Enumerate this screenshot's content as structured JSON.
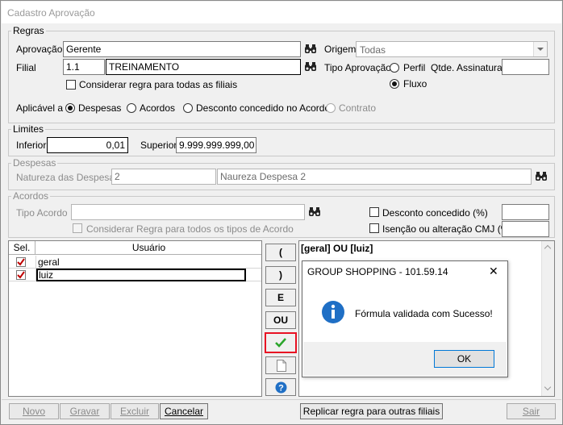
{
  "window": {
    "title": "Cadastro Aprovação"
  },
  "regras": {
    "legend": "Regras",
    "aprovacao_label": "Aprovação",
    "aprovacao_value": "Gerente",
    "origem_label": "Origem",
    "origem_value": "Todas",
    "filial_label": "Filial",
    "filial_code": "1.1",
    "filial_name": "TREINAMENTO",
    "tipo_aprovacao_label": "Tipo Aprovação",
    "perfil_label": "Perfil",
    "fluxo_label": "Fluxo",
    "qtde_label": "Qtde. Assinaturas",
    "qtde_value": "",
    "considerar_filiais_label": "Considerar regra para todas as filiais",
    "aplicavel_label": "Aplicável a",
    "aplicavel_options": [
      "Despesas",
      "Acordos",
      "Desconto concedido no Acordo",
      "Contrato"
    ]
  },
  "limites": {
    "legend": "Limites",
    "inferior_label": "Inferior",
    "inferior_value": "0,01",
    "superior_label": "Superior",
    "superior_value": "9.999.999.999,00"
  },
  "despesas": {
    "legend": "Despesas",
    "natureza_label": "Natureza das Despesas",
    "natureza_code": "2",
    "natureza_name": "Naureza Despesa 2"
  },
  "acordos": {
    "legend": "Acordos",
    "tipo_acordo_label": "Tipo Acordo",
    "tipo_acordo_value": "",
    "considerar_tipos_label": "Considerar Regra para todos os tipos de Acordo",
    "desconto_label": "Desconto concedido (%)",
    "desconto_value": "",
    "isencao_label": "Isenção ou alteração CMJ (%)",
    "isencao_value": ""
  },
  "users_table": {
    "headers": [
      "Sel.",
      "Usuário"
    ],
    "rows": [
      {
        "user": "geral"
      },
      {
        "user": "luiz"
      }
    ]
  },
  "operators": {
    "open": "(",
    "close": ")",
    "and": "E",
    "or": "OU"
  },
  "formula": "[geral] OU [luiz]",
  "dialog": {
    "title": "GROUP SHOPPING - 101.59.14",
    "message": "Fórmula validada com Sucesso!",
    "ok": "OK",
    "close_glyph": "✕"
  },
  "bottom": {
    "novo": "Novo",
    "gravar": "Gravar",
    "excluir": "Excluir",
    "cancelar": "Cancelar",
    "replicar": "Replicar regra para outras filiais",
    "sair": "Sair"
  },
  "colors": {
    "accent_border": "#e81123",
    "check_green": "#2aa52a",
    "info_blue": "#1f6fc5"
  }
}
